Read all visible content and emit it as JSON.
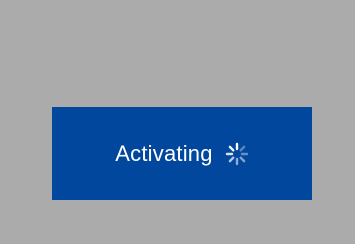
{
  "activation_button": {
    "label": "Activating",
    "spinner_icon": "loading-spinner-icon",
    "background_color": "#00479d",
    "text_color": "#ffffff"
  },
  "panel": {
    "background_color": "#ababab"
  }
}
